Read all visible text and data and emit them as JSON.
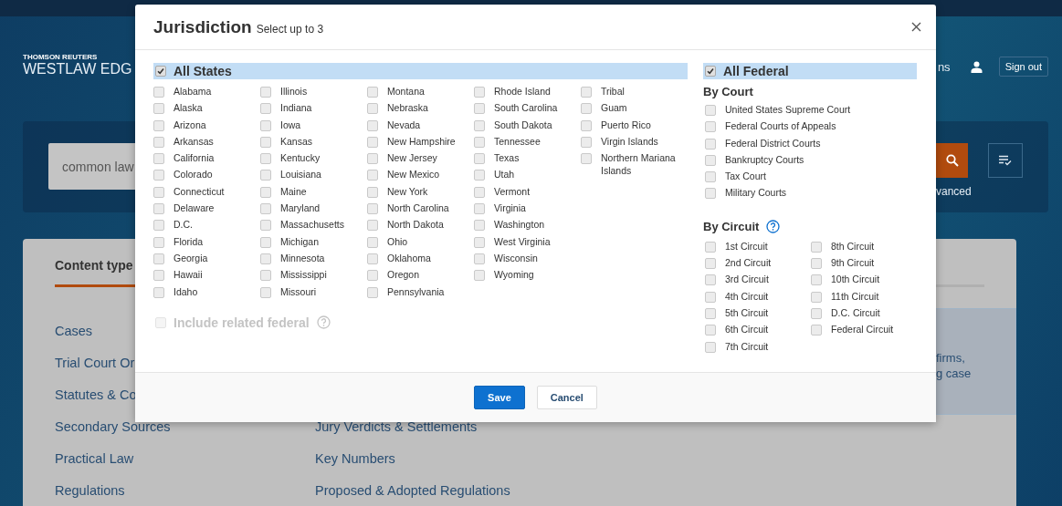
{
  "header": {
    "brand_top": "THOMSON REUTERS",
    "brand": "WESTLAW EDG",
    "nav_fragment": "ns",
    "sign_out": "Sign out"
  },
  "search": {
    "value": "common law",
    "advanced_fragment": "vanced"
  },
  "content": {
    "heading": "Content type",
    "left_links": [
      "Cases",
      "Trial Court Or",
      "Statutes & Co",
      "Secondary Sources",
      "Practical Law",
      "Regulations"
    ],
    "middle_links": [
      "Jury Verdicts & Settlements",
      "Key Numbers",
      "Proposed & Adopted Regulations"
    ],
    "info_lines": [
      "firms,",
      "g case"
    ]
  },
  "dialog": {
    "title": "Jurisdiction",
    "subtitle": "Select up to 3",
    "all_states": {
      "label": "All States",
      "checked": true
    },
    "states": [
      [
        {
          "label": "Alabama",
          "checked": false
        },
        {
          "label": "Alaska",
          "checked": false
        },
        {
          "label": "Arizona",
          "checked": false
        },
        {
          "label": "Arkansas",
          "checked": false
        },
        {
          "label": "California",
          "checked": false
        },
        {
          "label": "Colorado",
          "checked": false
        },
        {
          "label": "Connecticut",
          "checked": false
        },
        {
          "label": "Delaware",
          "checked": false
        },
        {
          "label": "D.C.",
          "checked": false
        },
        {
          "label": "Florida",
          "checked": false
        },
        {
          "label": "Georgia",
          "checked": false
        },
        {
          "label": "Hawaii",
          "checked": false
        },
        {
          "label": "Idaho",
          "checked": false
        }
      ],
      [
        {
          "label": "Illinois",
          "checked": false
        },
        {
          "label": "Indiana",
          "checked": false
        },
        {
          "label": "Iowa",
          "checked": false
        },
        {
          "label": "Kansas",
          "checked": false
        },
        {
          "label": "Kentucky",
          "checked": false
        },
        {
          "label": "Louisiana",
          "checked": false
        },
        {
          "label": "Maine",
          "checked": false
        },
        {
          "label": "Maryland",
          "checked": false
        },
        {
          "label": "Massachusetts",
          "checked": false
        },
        {
          "label": "Michigan",
          "checked": false
        },
        {
          "label": "Minnesota",
          "checked": false
        },
        {
          "label": "Mississippi",
          "checked": false
        },
        {
          "label": "Missouri",
          "checked": false
        }
      ],
      [
        {
          "label": "Montana",
          "checked": false
        },
        {
          "label": "Nebraska",
          "checked": false
        },
        {
          "label": "Nevada",
          "checked": false
        },
        {
          "label": "New Hampshire",
          "checked": false
        },
        {
          "label": "New Jersey",
          "checked": false
        },
        {
          "label": "New Mexico",
          "checked": false
        },
        {
          "label": "New York",
          "checked": false
        },
        {
          "label": "North Carolina",
          "checked": false
        },
        {
          "label": "North Dakota",
          "checked": false
        },
        {
          "label": "Ohio",
          "checked": false
        },
        {
          "label": "Oklahoma",
          "checked": false
        },
        {
          "label": "Oregon",
          "checked": false
        },
        {
          "label": "Pennsylvania",
          "checked": false
        }
      ],
      [
        {
          "label": "Rhode Island",
          "checked": false
        },
        {
          "label": "South Carolina",
          "checked": false
        },
        {
          "label": "South Dakota",
          "checked": false
        },
        {
          "label": "Tennessee",
          "checked": false
        },
        {
          "label": "Texas",
          "checked": false
        },
        {
          "label": "Utah",
          "checked": false
        },
        {
          "label": "Vermont",
          "checked": false
        },
        {
          "label": "Virginia",
          "checked": false
        },
        {
          "label": "Washington",
          "checked": false
        },
        {
          "label": "West Virginia",
          "checked": false
        },
        {
          "label": "Wisconsin",
          "checked": false
        },
        {
          "label": "Wyoming",
          "checked": false
        }
      ],
      [
        {
          "label": "Tribal",
          "checked": false
        },
        {
          "label": "Guam",
          "checked": false
        },
        {
          "label": "Puerto Rico",
          "checked": false
        },
        {
          "label": "Virgin Islands",
          "checked": false
        },
        {
          "label": "Northern Mariana Islands",
          "checked": false
        }
      ]
    ],
    "include_related": {
      "label": "Include related federal",
      "checked": false,
      "disabled": true
    },
    "all_federal": {
      "label": "All Federal",
      "checked": true
    },
    "by_court": {
      "heading": "By Court",
      "items": [
        {
          "label": "United States Supreme Court",
          "checked": false
        },
        {
          "label": "Federal Courts of Appeals",
          "checked": false
        },
        {
          "label": "Federal District Courts",
          "checked": false
        },
        {
          "label": "Bankruptcy Courts",
          "checked": false
        },
        {
          "label": "Tax Court",
          "checked": false
        },
        {
          "label": "Military Courts",
          "checked": false
        }
      ]
    },
    "by_circuit": {
      "heading": "By Circuit",
      "columns": [
        [
          {
            "label": "1st Circuit",
            "checked": false
          },
          {
            "label": "2nd Circuit",
            "checked": false
          },
          {
            "label": "3rd Circuit",
            "checked": false
          },
          {
            "label": "4th Circuit",
            "checked": false
          },
          {
            "label": "5th Circuit",
            "checked": false
          },
          {
            "label": "6th Circuit",
            "checked": false
          },
          {
            "label": "7th Circuit",
            "checked": false
          }
        ],
        [
          {
            "label": "8th Circuit",
            "checked": false
          },
          {
            "label": "9th Circuit",
            "checked": false
          },
          {
            "label": "10th Circuit",
            "checked": false
          },
          {
            "label": "11th Circuit",
            "checked": false
          },
          {
            "label": "D.C. Circuit",
            "checked": false
          },
          {
            "label": "Federal Circuit",
            "checked": false
          }
        ]
      ]
    },
    "buttons": [
      {
        "label": "Save",
        "kind": "primary"
      },
      {
        "label": "Cancel",
        "kind": "secondary"
      }
    ]
  }
}
